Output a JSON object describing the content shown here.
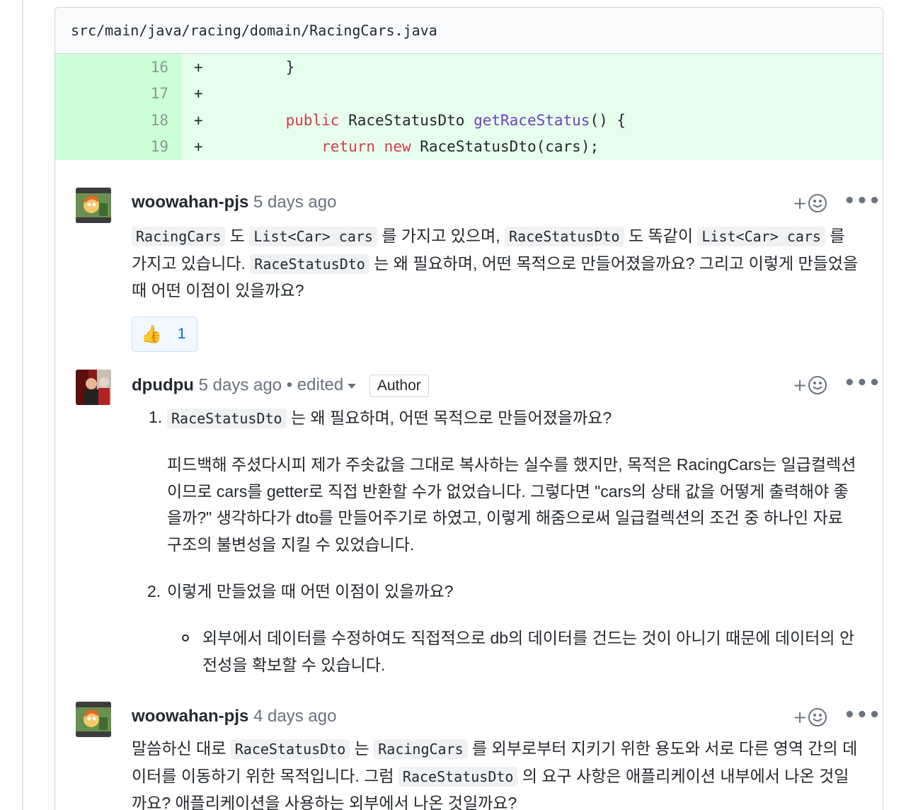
{
  "file": {
    "path": "src/main/java/racing/domain/RacingCars.java"
  },
  "diff": [
    {
      "num": "16",
      "sign": "+",
      "parts": [
        {
          "t": "    }",
          "c": ""
        }
      ]
    },
    {
      "num": "17",
      "sign": "+",
      "parts": [
        {
          "t": "",
          "c": ""
        }
      ]
    },
    {
      "num": "18",
      "sign": "+",
      "parts": [
        {
          "t": "    ",
          "c": ""
        },
        {
          "t": "public",
          "c": "kw"
        },
        {
          "t": " RaceStatusDto ",
          "c": ""
        },
        {
          "t": "getRaceStatus",
          "c": "fn"
        },
        {
          "t": "() {",
          "c": ""
        }
      ]
    },
    {
      "num": "19",
      "sign": "+",
      "parts": [
        {
          "t": "        ",
          "c": ""
        },
        {
          "t": "return",
          "c": "kw"
        },
        {
          "t": " ",
          "c": ""
        },
        {
          "t": "new",
          "c": "kw"
        },
        {
          "t": " RaceStatusDto(cars);",
          "c": ""
        }
      ]
    }
  ],
  "comments": {
    "c1": {
      "author": "woowahan-pjs",
      "time": "5 days ago",
      "code1": "RacingCars",
      "t1": " 도 ",
      "code2": "List<Car> cars",
      "t2": " 를 가지고 있으며, ",
      "code3": "RaceStatusDto",
      "t3": " 도 똑같이 ",
      "code4": "List<Car> cars",
      "t4": " 를 가지고 있습니다. ",
      "code5": "RaceStatusDto",
      "t5": " 는 왜 필요하며, 어떤 목적으로 만들어졌을까요? 그리고 이렇게 만들었을 때 어떤 이점이 있을까요?",
      "reaction_emoji": "👍",
      "reaction_count": "1"
    },
    "c2": {
      "author": "dpudpu",
      "time": "5 days ago",
      "edited": "• edited",
      "badge": "Author",
      "item1_marker": "1.",
      "item1_code": "RaceStatusDto",
      "item1_text": " 는 왜 필요하며, 어떤 목적으로 만들어졌을까요?",
      "item1_para": "피드백해 주셨다시피 제가 주솟값을 그대로 복사하는 실수를 했지만, 목적은 RacingCars는 일급컬렉션이므로 cars를 getter로 직접 반환할 수가 없었습니다. 그렇다면 \"cars의 상태 값을 어떻게 출력해야 좋을까?\" 생각하다가 dto를 만들어주기로 하였고, 이렇게 해줌으로써 일급컬렉션의 조건 중 하나인 자료구조의 불변성을 지킬 수 있었습니다.",
      "item2_marker": "2.",
      "item2_text": "이렇게 만들었을 때 어떤 이점이 있을까요?",
      "item2_bullet": "외부에서 데이터를 수정하여도 직접적으로 db의 데이터를 건드는 것이 아니기 때문에 데이터의 안전성을 확보할 수 있습니다."
    },
    "c3": {
      "author": "woowahan-pjs",
      "time": "4 days ago",
      "t1": "말씀하신 대로 ",
      "code1": "RaceStatusDto",
      "t2": " 는 ",
      "code2": "RacingCars",
      "t3": " 를 외부로부터 지키기 위한 용도와 서로 다른 영역 간의 데이터를 이동하기 위한 목적입니다. 그럼 ",
      "code3": "RaceStatusDto",
      "t4": " 의 요구 사항은 애플리케이션 내부에서 나온 것일까요? 애플리케이션을 사용하는 외부에서 나온 것일까요?"
    }
  },
  "icons": {
    "add_reaction": "smiley-plus-icon",
    "more": "kebab-horizontal-icon"
  },
  "colors": {
    "diff_add_bg": "#e6ffed",
    "diff_add_gutter": "#cdffd8",
    "keyword": "#d73a49",
    "function": "#6f42c1"
  }
}
